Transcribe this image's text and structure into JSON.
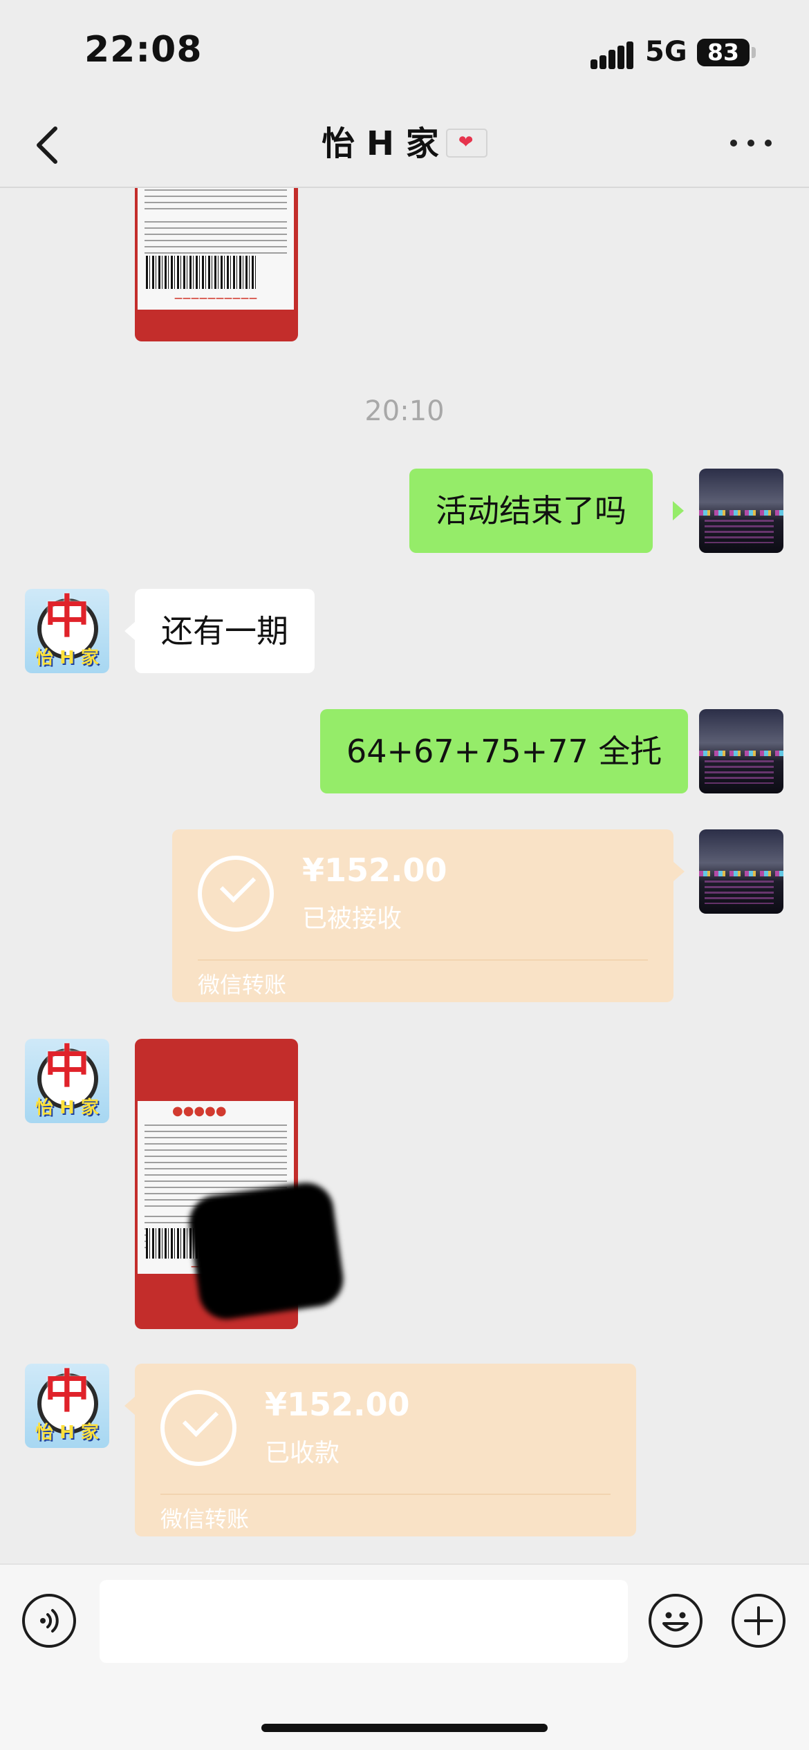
{
  "status_bar": {
    "time": "22:08",
    "network": "5G",
    "battery": "83"
  },
  "header": {
    "title": "怡 H 家"
  },
  "timestamp": "20:10",
  "messages": {
    "m1": "活动结束了吗",
    "m2": "还有一期",
    "m3": "64+67+75+77 全托",
    "transfer1": {
      "amount": "¥152.00",
      "status": "已被接收",
      "label": "微信转账"
    },
    "transfer2": {
      "amount": "¥152.00",
      "status": "已收款",
      "label": "微信转账"
    }
  },
  "contact_avatar": {
    "glyph": "中",
    "name": "怡 H 家"
  },
  "input": {
    "placeholder": ""
  }
}
